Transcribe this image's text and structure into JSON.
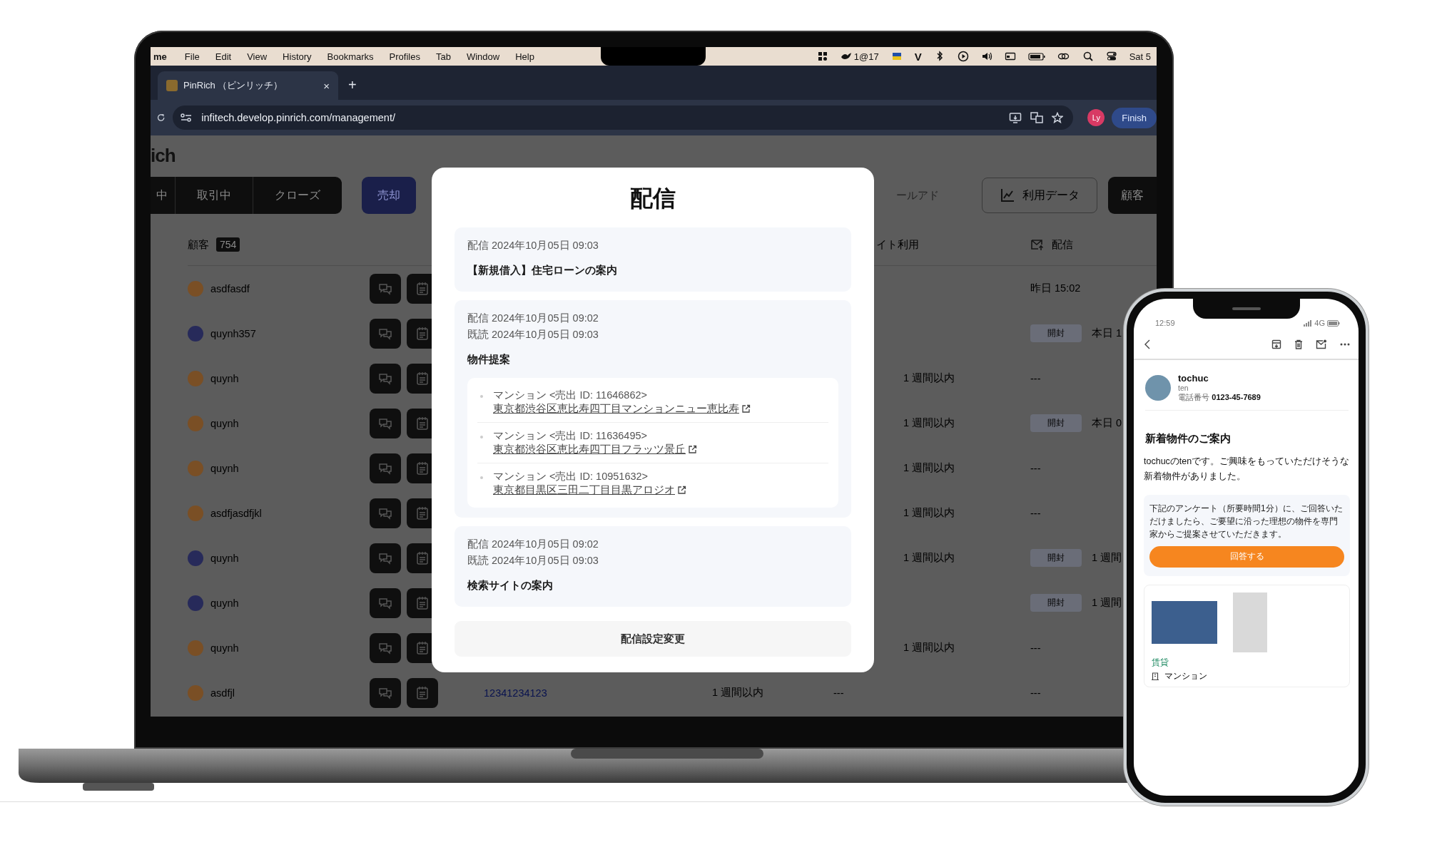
{
  "menu_bar": {
    "app_name": "me",
    "menus": [
      "File",
      "Edit",
      "View",
      "History",
      "Bookmarks",
      "Profiles",
      "Tab",
      "Window",
      "Help"
    ],
    "status_text": "1@17",
    "status_letter": "V",
    "clock": "Sat 5"
  },
  "browser": {
    "tabs": [
      {
        "title": "PinRich （ピンリッチ）",
        "close": "×",
        "selected": true
      }
    ],
    "new_tab": "+",
    "url": "infitech.develop.pinrich.com/management/",
    "profile": "Ly",
    "finish_button": "Finish"
  },
  "app": {
    "logo": "ich",
    "status_tabs": [
      {
        "label": "中",
        "selected": false
      },
      {
        "label": "取引中",
        "selected": false
      },
      {
        "label": "クローズ",
        "selected": false
      },
      {
        "label": "売却",
        "selected": true
      }
    ],
    "filter": {
      "label": "ールアド",
      "disabled": true
    },
    "buttons": [
      {
        "label": "利用データ",
        "kind": "outline"
      },
      {
        "label": "顧客",
        "kind": "solid"
      }
    ],
    "table": {
      "customer_header": "顧客",
      "customer_count": "754",
      "site_header": "イト利用",
      "delivery_header": "配信",
      "rows": [
        {
          "name": "asdfasdf",
          "color": "#7a4f25",
          "delivery_time": "昨日 15:02"
        },
        {
          "name": "quynh357",
          "color": "#272a5a",
          "delivery_badge": "開封",
          "delivery_time": "本日 1"
        },
        {
          "name": "quynh",
          "color": "#7a4f25",
          "site": "1 週間以内",
          "delivery_time": "---"
        },
        {
          "name": "quynh",
          "color": "#7a4f25",
          "site": "1 週間以内",
          "delivery_badge": "開封",
          "delivery_time": "本日 0"
        },
        {
          "name": "quynh",
          "color": "#7a4f25",
          "site": "1 週間以内",
          "delivery_time": "---"
        },
        {
          "name": "asdfjasdfjkl",
          "color": "#7a4f25",
          "site": "1 週間以内",
          "delivery_time": "---"
        },
        {
          "name": "quynh",
          "color": "#272a5a",
          "site": "1 週間以内",
          "delivery_badge": "開封",
          "delivery_time": "1 週間"
        },
        {
          "name": "quynh",
          "color": "#272a5a",
          "delivery_badge": "開封",
          "delivery_time": "1 週間"
        },
        {
          "name": "quynh",
          "color": "#7a4f25",
          "site": "1 週間以内",
          "delivery_time": "---"
        },
        {
          "name": "asdfjl",
          "color": "#7a4f25",
          "phone": "12341234123",
          "last_visit": "1 週間以内",
          "column_5": "---",
          "delivery_time": "---"
        }
      ]
    }
  },
  "modal": {
    "title": "配信",
    "items": [
      {
        "sent": "配信 2024年10月05日 09:03",
        "subject": "【新規借入】住宅ローンの案内"
      },
      {
        "sent": "配信 2024年10月05日 09:02",
        "read": "既読 2024年10月05日 09:03",
        "subject": "物件提案",
        "properties": [
          {
            "label": "マンション <売出 ID: 11646862>",
            "link": "東京都渋谷区恵比寿四丁目マンションニュー恵比寿"
          },
          {
            "label": "マンション <売出 ID: 11636495>",
            "link": "東京都渋谷区恵比寿四丁目フラッツ景丘"
          },
          {
            "label": "マンション <売出 ID: 10951632>",
            "link": "東京都目黒区三田二丁目目黒アロジオ"
          }
        ]
      },
      {
        "sent": "配信 2024年10月05日 09:02",
        "read": "既読 2024年10月05日 09:03",
        "subject": "検索サイトの案内"
      }
    ],
    "settings_button": "配信設定変更"
  },
  "phone": {
    "time": "12:59",
    "network": "4G",
    "sender": {
      "name": "tochuc",
      "sub": "ten",
      "phone_label": "電話番号",
      "phone": "0123-45-7689"
    },
    "heading": "新着物件のご案内",
    "body": "tochucのtenです。ご興味をもっていただけそうな新着物件がありました。",
    "survey": {
      "text": "下記のアンケート（所要時間1分）に、ご回答いただけましたら、ご要望に沿った理想の物件を専門家からご提案させていただきます。",
      "button": "回答する"
    },
    "property": {
      "tag": "賃貸",
      "type": "マンション"
    }
  }
}
